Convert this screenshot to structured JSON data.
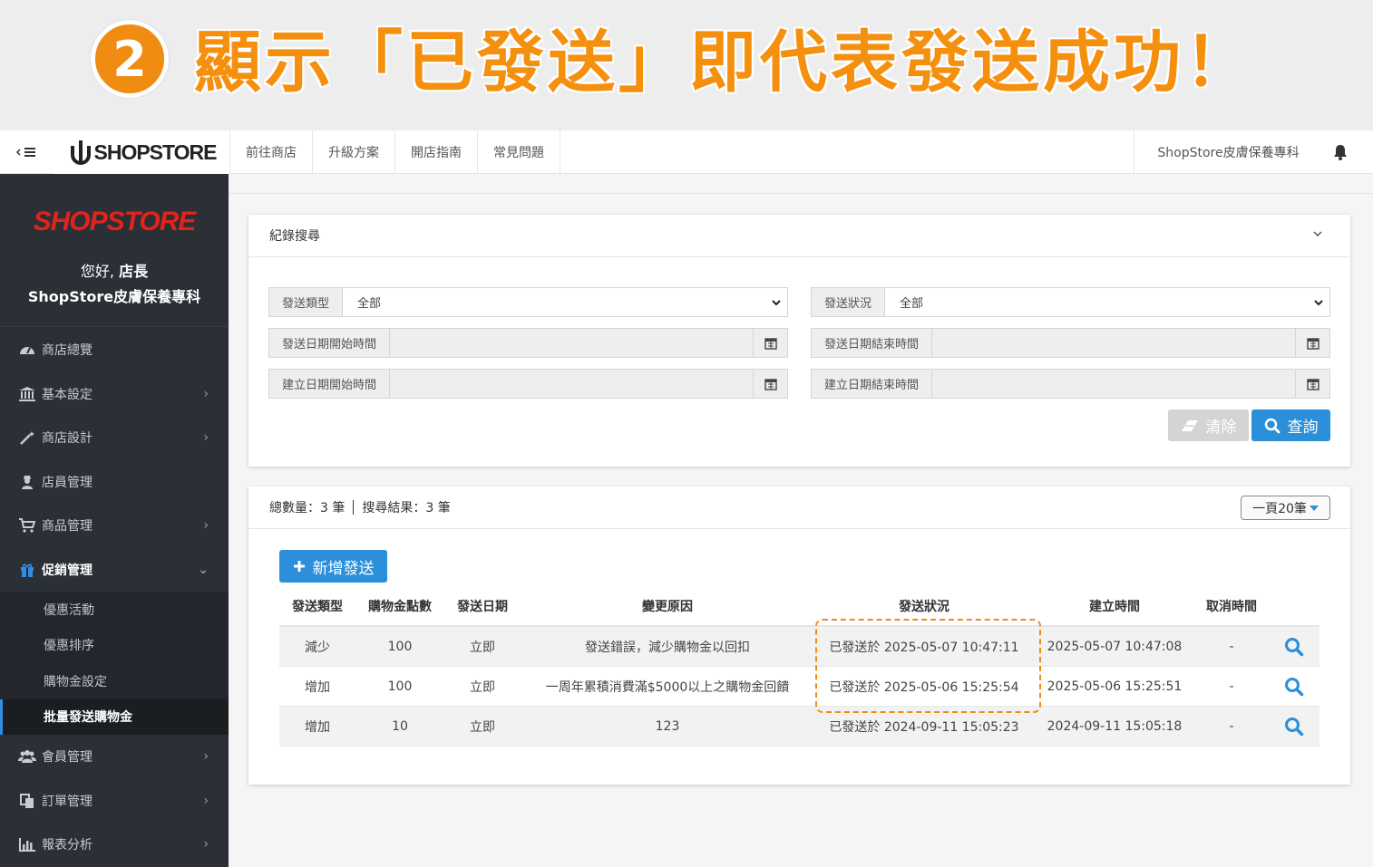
{
  "banner": {
    "number": "2",
    "text": "顯示「已發送」即代表發送成功！",
    "color": "#f5900f"
  },
  "topnav": {
    "logo": "SHOPSTORE",
    "links": [
      "前往商店",
      "升級方案",
      "開店指南",
      "常見問題"
    ],
    "store_name": "ShopStore皮膚保養專科"
  },
  "sidebar": {
    "logo": "SHOPSTORE",
    "greeting": "您好,",
    "role": "店長",
    "store_name": "ShopStore皮膚保養專科",
    "items": [
      {
        "label": "商店總覽",
        "icon": "dashboard-icon"
      },
      {
        "label": "基本設定",
        "icon": "bank-icon"
      },
      {
        "label": "商店設計",
        "icon": "magic-wand-icon"
      },
      {
        "label": "店員管理",
        "icon": "user-secret-icon"
      },
      {
        "label": "商品管理",
        "icon": "cart-icon"
      },
      {
        "label": "促銷管理",
        "icon": "gift-icon"
      },
      {
        "label": "會員管理",
        "icon": "users-icon"
      },
      {
        "label": "訂單管理",
        "icon": "copy-icon"
      },
      {
        "label": "報表分析",
        "icon": "bar-chart-icon"
      }
    ],
    "subitems": [
      "優惠活動",
      "優惠排序",
      "購物金設定",
      "批量發送購物金"
    ]
  },
  "search": {
    "title": "紀錄搜尋",
    "send_type_label": "發送類型",
    "send_type_value": "全部",
    "send_status_label": "發送狀況",
    "send_status_value": "全部",
    "send_start_label": "發送日期開始時間",
    "send_end_label": "發送日期結束時間",
    "create_start_label": "建立日期開始時間",
    "create_end_label": "建立日期結束時間",
    "clear_label": "清除",
    "query_label": "查詢"
  },
  "list": {
    "total": "總數量：3 筆",
    "result": "搜尋結果：3 筆",
    "per_page": "一頁20筆",
    "add_label": "新增發送",
    "headers": [
      "發送類型",
      "購物金點數",
      "發送日期",
      "變更原因",
      "發送狀況",
      "建立時間",
      "取消時間"
    ],
    "rows": [
      {
        "type": "減少",
        "points": "100",
        "date": "立即",
        "reason": "發送錯誤，減少購物金以回扣",
        "status": "已發送於 2025-05-07 10:47:11",
        "created": "2025-05-07 10:47:08",
        "cancelled": "-"
      },
      {
        "type": "增加",
        "points": "100",
        "date": "立即",
        "reason": "一周年累積消費滿$5000以上之購物金回饋",
        "status": "已發送於 2025-05-06 15:25:54",
        "created": "2025-05-06 15:25:51",
        "cancelled": "-"
      },
      {
        "type": "增加",
        "points": "10",
        "date": "立即",
        "reason": "123",
        "status": "已發送於 2024-09-11 15:05:23",
        "created": "2024-09-11 15:05:18",
        "cancelled": "-"
      }
    ]
  },
  "colors": {
    "accent": "#2b8fd9",
    "highlight": "#f08c12",
    "sidebar": "#2b2f36"
  }
}
